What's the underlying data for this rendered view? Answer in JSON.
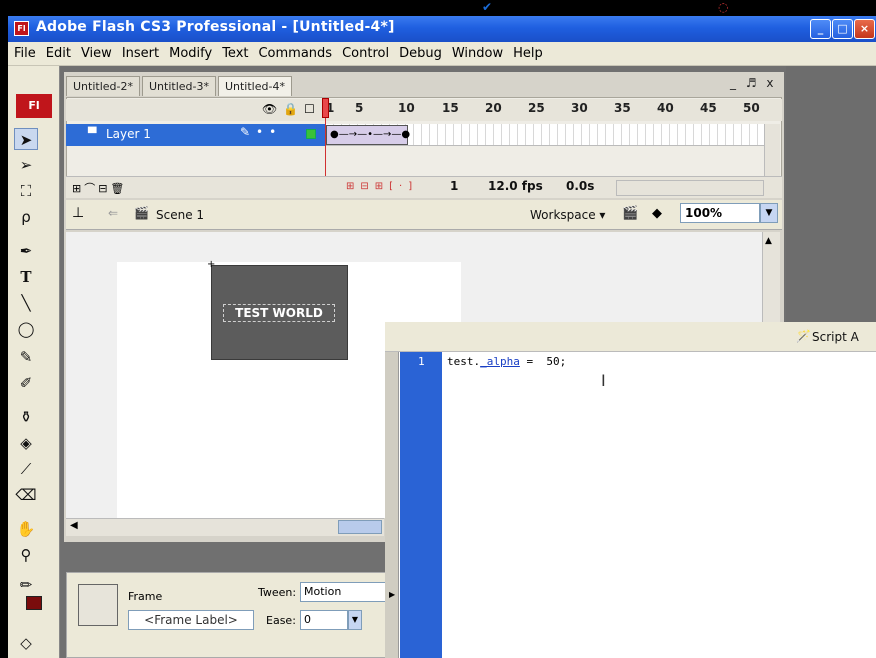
{
  "window": {
    "title": "Adobe Flash CS3 Professional - [Untitled-4*]",
    "app_icon": "Fl",
    "controls": [
      "_",
      "□",
      "×"
    ]
  },
  "menu": [
    "File",
    "Edit",
    "View",
    "Insert",
    "Modify",
    "Text",
    "Commands",
    "Control",
    "Debug",
    "Window",
    "Help"
  ],
  "tools": {
    "logo": "Fl",
    "items": [
      "selection-arrow",
      "subselection-arrow",
      "free-transform",
      "lasso",
      "pen",
      "text",
      "line",
      "oval",
      "pencil",
      "brush",
      "ink-bottle",
      "paint-bucket",
      "eyedropper",
      "eraser",
      "hand",
      "zoom",
      "stroke-color",
      "fill-color"
    ]
  },
  "documents": {
    "tabs": [
      "Untitled-2*",
      "Untitled-3*",
      "Untitled-4*"
    ],
    "active": "Untitled-4*",
    "controls": "_ ♬ x"
  },
  "timeline": {
    "frame_numbers": [
      "1",
      "5",
      "10",
      "15",
      "20",
      "25",
      "30",
      "35",
      "40",
      "45",
      "50"
    ],
    "layer_name": "Layer 1",
    "current_frame": "1",
    "frame_rate": "12.0 fps",
    "elapsed": "0.0s"
  },
  "editbar": {
    "scene": "Scene 1",
    "workspace": "Workspace ▾",
    "zoom": "100%"
  },
  "stage": {
    "text_field": "TEST WORLD"
  },
  "properties": {
    "frame_label_title": "Frame",
    "frame_label_placeholder": "<Frame Label>",
    "tween_label": "Tween:",
    "tween_value": "Motion",
    "ease_label": "Ease:",
    "ease_value": "0"
  },
  "actions": {
    "line_number": "1",
    "code_object": "test.",
    "code_property": "_alpha",
    "code_rest": " =  50;",
    "script_assist": "Script A"
  }
}
